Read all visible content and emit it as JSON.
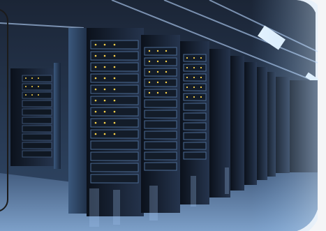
{
  "image": {
    "subject-icon": "server-room-photo"
  },
  "colors": {
    "background": "#f4f5f7",
    "rack_dark": "#0e1420",
    "rack_mid": "#27354e",
    "floor_blue": "#4d6f9e",
    "light_blue": "#d7ecff",
    "accent_yellow": "#ffd54a",
    "frame": "#1b1b1b"
  }
}
